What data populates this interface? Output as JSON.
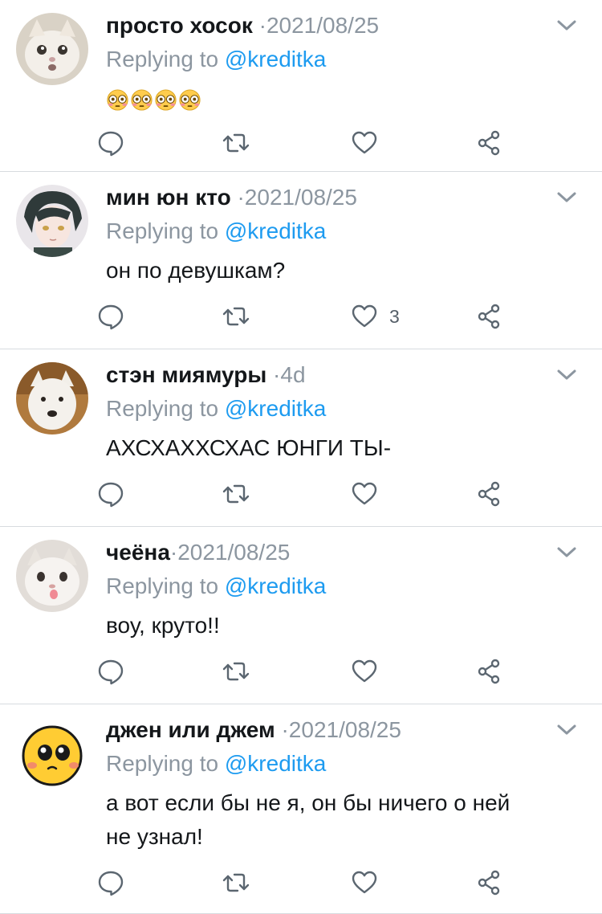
{
  "replying_label": "Replying to",
  "reply_handle": "@kreditka",
  "colors": {
    "accent": "#1d9bf0",
    "muted": "#8c96a0",
    "divider": "#d7dbdf"
  },
  "replies": [
    {
      "name": "просто хосок",
      "time": "2021/08/25",
      "text": "",
      "emoji": [
        "flushed-face",
        "flushed-face",
        "flushed-face",
        "flushed-face"
      ],
      "like_count": "",
      "avatar": "white-cat-photo"
    },
    {
      "name": "мин юн кто",
      "time": "2021/08/25",
      "text": "он по девушкам?",
      "like_count": "3",
      "avatar": "anime-character"
    },
    {
      "name": "стэн миямуры",
      "time": "4d",
      "text": "АХСХАХХСХАС ЮНГИ ТЫ-",
      "like_count": "",
      "avatar": "white-dog-photo"
    },
    {
      "name": "чеёна",
      "time": "2021/08/25",
      "text": "воу, круто!!",
      "like_count": "",
      "avatar": "cat-tongue-photo"
    },
    {
      "name": "джен или джем",
      "time": "2021/08/25",
      "text_line1": "а вот если бы не я, он бы ничего о ней",
      "text_line2": "не узнал!",
      "like_count": "",
      "avatar": "yellow-emoji-face"
    }
  ],
  "icons": {
    "reply": "comment-icon",
    "retweet": "retweet-icon",
    "like": "heart-icon",
    "share": "share-icon",
    "more": "chevron-down-icon"
  }
}
